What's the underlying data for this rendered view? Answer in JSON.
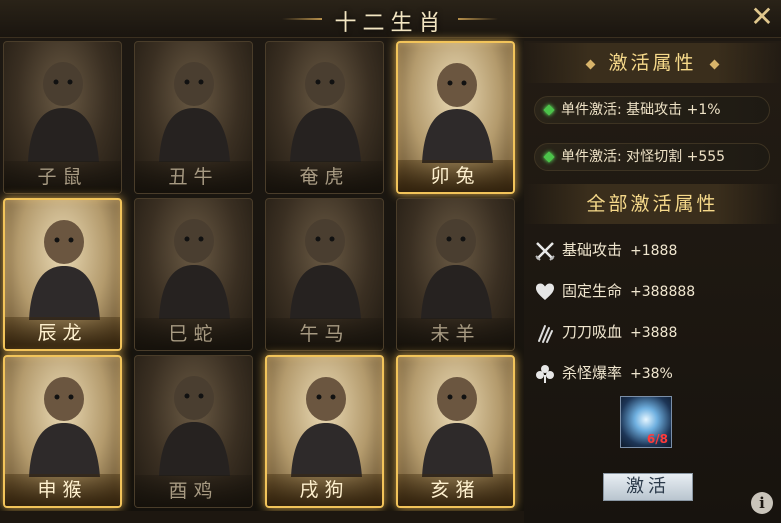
{
  "header": {
    "title": "十二生肖",
    "close_icon": "close-x-icon"
  },
  "zodiac": [
    {
      "label": "子鼠",
      "active": false
    },
    {
      "label": "丑牛",
      "active": false
    },
    {
      "label": "奄虎",
      "active": false
    },
    {
      "label": "卯兔",
      "active": true
    },
    {
      "label": "辰龙",
      "active": true
    },
    {
      "label": "巳蛇",
      "active": false
    },
    {
      "label": "午马",
      "active": false
    },
    {
      "label": "未羊",
      "active": false
    },
    {
      "label": "申猴",
      "active": true
    },
    {
      "label": "酉鸡",
      "active": false
    },
    {
      "label": "戌狗",
      "active": true
    },
    {
      "label": "亥猪",
      "active": true
    }
  ],
  "panel": {
    "activate_title": "激活属性",
    "set_rows": [
      "单件激活: 基础攻击 +1%",
      "单件激活: 对怪切割 +555"
    ],
    "all_title": "全部激活属性",
    "all_rows": [
      {
        "icon": "crossed-swords-icon",
        "name": "基础攻击",
        "value": "+1888"
      },
      {
        "icon": "heart-icon",
        "name": "固定生命",
        "value": "+388888"
      },
      {
        "icon": "claw-slash-icon",
        "name": "刀刀吸血",
        "value": "+3888"
      },
      {
        "icon": "clover-icon",
        "name": "杀怪爆率",
        "value": "+38%"
      }
    ],
    "item": {
      "icon": "crystal-orb-icon",
      "count": "6/8"
    },
    "activate_button": "激活",
    "info_icon": "info-icon",
    "info_glyph": "i"
  },
  "colors": {
    "gold": "#f2c45a",
    "green_gem": "#4cc24a",
    "count_red": "#ff3a3a"
  }
}
